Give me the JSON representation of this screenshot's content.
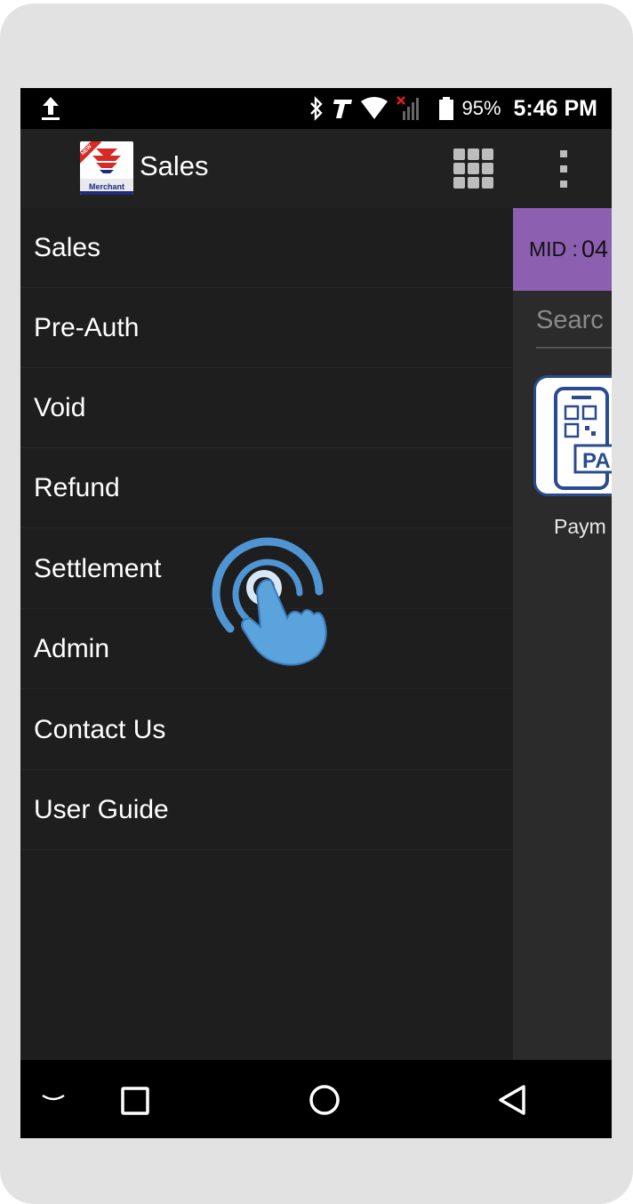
{
  "status_bar": {
    "battery_percent": "95%",
    "time": "5:46 PM",
    "icons": [
      "upload-icon",
      "bluetooth-icon",
      "t-mobile-icon",
      "wifi-icon",
      "signal-off-icon",
      "battery-icon"
    ]
  },
  "app_bar": {
    "title": "Sales",
    "logo_text": "Merchant",
    "logo_badge": "NEW"
  },
  "drawer": {
    "items": [
      {
        "label": "Sales"
      },
      {
        "label": "Pre-Auth"
      },
      {
        "label": "Void"
      },
      {
        "label": "Refund"
      },
      {
        "label": "Settlement"
      },
      {
        "label": "Admin"
      },
      {
        "label": "Contact Us"
      },
      {
        "label": "User Guide"
      }
    ]
  },
  "background": {
    "mid_label": "MID :",
    "mid_value": "04",
    "search_placeholder": "Searc",
    "pay_tile_text": "PA",
    "pay_label": "Paym"
  },
  "colors": {
    "accent_purple": "#8d5fb0",
    "drawer_bg": "#1e1e1e",
    "card_border": "#2a4b8d",
    "cursor_blue": "#5aa3dd"
  }
}
